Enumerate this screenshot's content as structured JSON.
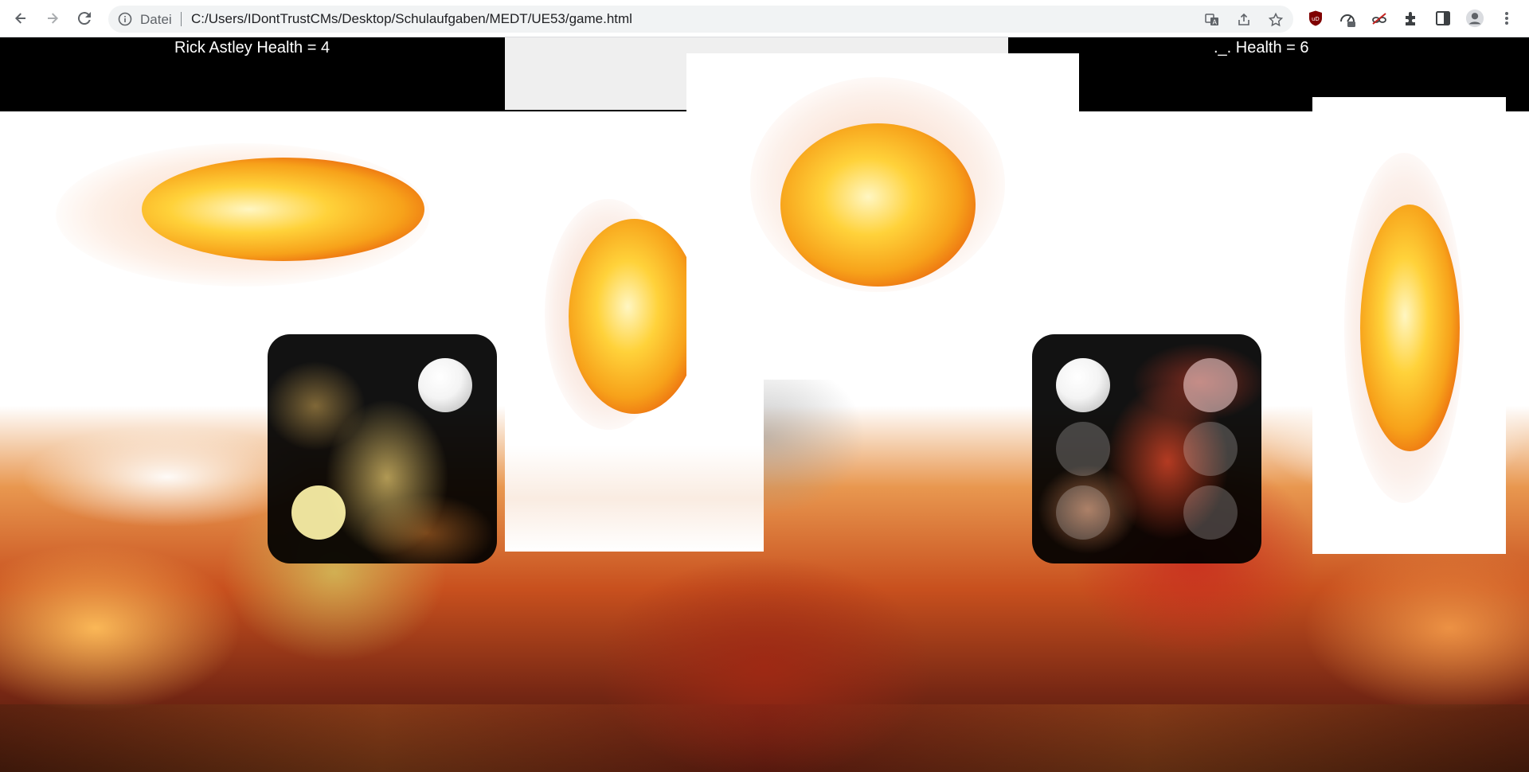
{
  "browser": {
    "back_icon": "arrow-left-icon",
    "forward_icon": "arrow-right-icon",
    "reload_icon": "reload-icon",
    "info_icon": "info-icon",
    "scheme_label": "Datei",
    "url": "C:/Users/IDontTrustCMs/Desktop/Schulaufgaben/MEDT/UE53/game.html",
    "omnibox_icons": [
      "translate-icon",
      "share-icon",
      "star-icon"
    ],
    "extensions": [
      "ublock-origin-icon",
      "speed-dial-icon",
      "incognito-extension-icon",
      "puzzle-extensions-icon",
      "side-panel-icon",
      "profile-avatar-icon",
      "more-menu-icon"
    ]
  },
  "game": {
    "player1_health_label": "Rick Astley Health = 4",
    "player2_health_label": "._. Health = 6",
    "player1_health": 4,
    "player2_health": 6,
    "player1_die_value": 2,
    "player2_die_value": 6,
    "colors": {
      "header_background": "#000000",
      "die_background": "#000000",
      "pip_color": "#ffffff",
      "explosion_core": "#ffd23a",
      "explosion_edge": "#e85a0c"
    }
  }
}
